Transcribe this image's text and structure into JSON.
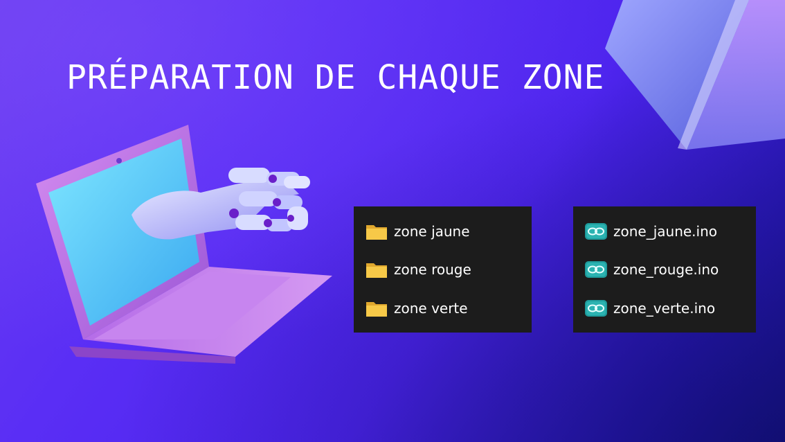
{
  "slide": {
    "title": "PRÉPARATION DE CHAQUE ZONE"
  },
  "folders_panel": {
    "items": [
      {
        "label": "zone jaune",
        "icon": "folder-icon"
      },
      {
        "label": "zone rouge",
        "icon": "folder-icon"
      },
      {
        "label": "zone verte",
        "icon": "folder-icon"
      }
    ]
  },
  "files_panel": {
    "items": [
      {
        "label": "zone_jaune.ino",
        "icon": "arduino-file-icon"
      },
      {
        "label": "zone_rouge.ino",
        "icon": "arduino-file-icon"
      },
      {
        "label": "zone_verte.ino",
        "icon": "arduino-file-icon"
      }
    ]
  },
  "colors": {
    "background": "#5a2ef5",
    "panel": "#1c1c1c",
    "folder": "#f7c948",
    "arduino": "#1f9c9c",
    "text": "#ffffff"
  }
}
